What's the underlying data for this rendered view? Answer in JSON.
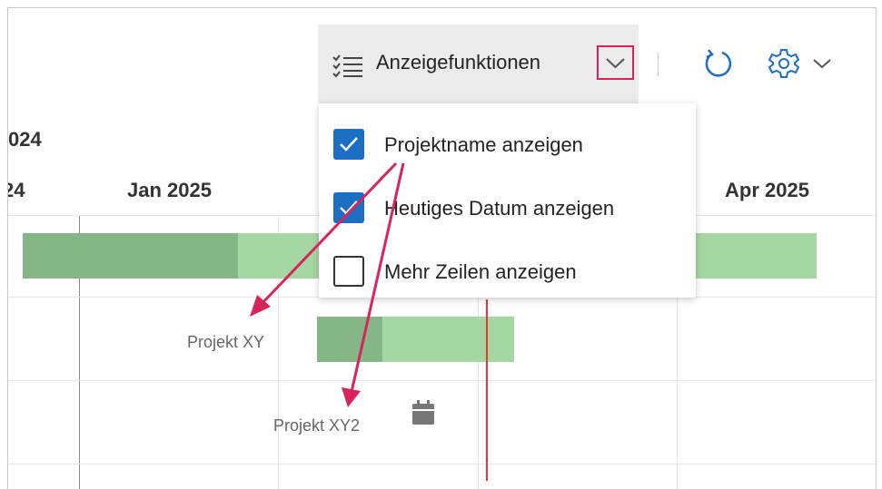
{
  "toolbar": {
    "display_button_label": "Anzeigefunktionen",
    "display_icon": "list-options-icon",
    "dropdown_icon": "chevron-down-icon",
    "refresh_icon": "refresh-icon",
    "settings_icon": "gear-icon",
    "highlight_color": "#d8245a"
  },
  "timeline": {
    "year_partial": "024",
    "months": [
      {
        "label": "24"
      },
      {
        "label": "Jan 2025"
      },
      {
        "label": "Apr 2025"
      }
    ],
    "today_color": "#e8363b"
  },
  "menu": {
    "items": [
      {
        "label": "Projektname anzeigen",
        "checked": true
      },
      {
        "label": "Heutiges Datum anzeigen",
        "checked": true
      },
      {
        "label": "Mehr Zeilen anzeigen",
        "checked": false
      }
    ],
    "check_color": "#1b6ec2"
  },
  "projects": [
    {
      "label": "Projekt XY"
    },
    {
      "label": "Projekt XY2",
      "icon": "calendar-icon"
    }
  ],
  "bar_colors": {
    "light": "#a4d7a2",
    "dark": "#86b587"
  }
}
